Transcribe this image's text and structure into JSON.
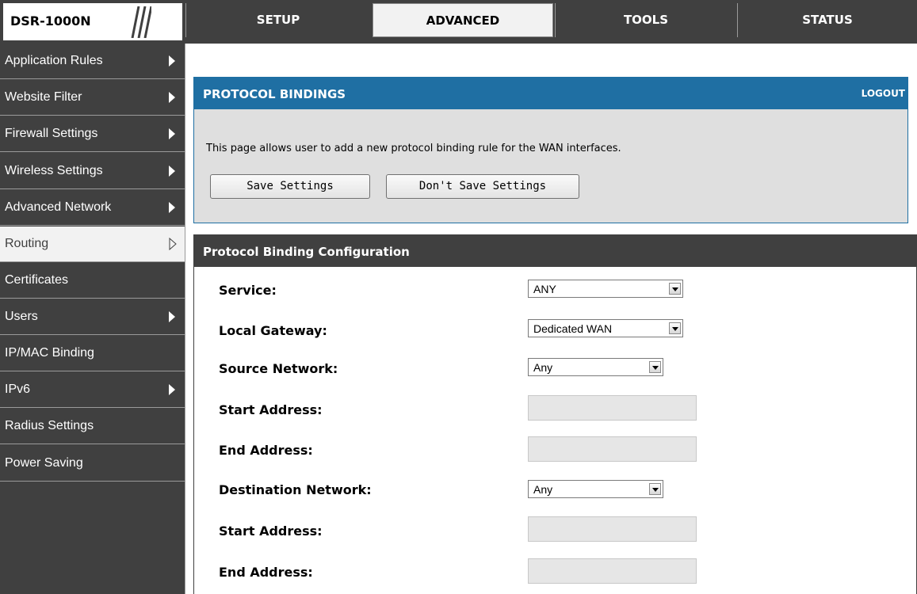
{
  "header": {
    "model": "DSR-1000N",
    "tabs": [
      {
        "label": "SETUP"
      },
      {
        "label": "ADVANCED"
      },
      {
        "label": "TOOLS"
      },
      {
        "label": "STATUS"
      }
    ],
    "active_tab": "ADVANCED"
  },
  "sidebar": {
    "items": [
      {
        "label": "Application Rules"
      },
      {
        "label": "Website Filter"
      },
      {
        "label": "Firewall Settings"
      },
      {
        "label": "Wireless Settings"
      },
      {
        "label": "Advanced Network"
      },
      {
        "label": "Routing"
      },
      {
        "label": "Certificates"
      },
      {
        "label": "Users"
      },
      {
        "label": "IP/MAC Binding"
      },
      {
        "label": "IPv6"
      },
      {
        "label": "Radius Settings"
      },
      {
        "label": "Power Saving"
      }
    ],
    "active_item": "Routing"
  },
  "intro": {
    "title": "PROTOCOL BINDINGS",
    "logout": "LOGOUT",
    "description": "This page allows user to add a new protocol binding rule for the WAN interfaces.",
    "save_label": "Save Settings",
    "dont_save_label": "Don't Save Settings"
  },
  "config": {
    "title": "Protocol Binding Configuration",
    "fields": [
      {
        "label": "Service:",
        "type": "select",
        "value": "ANY"
      },
      {
        "label": "Local Gateway:",
        "type": "select",
        "value": "Dedicated WAN"
      },
      {
        "label": "Source Network:",
        "type": "select",
        "value": "Any"
      },
      {
        "label": "Start Address:",
        "type": "text",
        "value": ""
      },
      {
        "label": "End Address:",
        "type": "text",
        "value": ""
      },
      {
        "label": "Destination Network:",
        "type": "select",
        "value": "Any"
      },
      {
        "label": "Start Address:",
        "type": "text",
        "value": ""
      },
      {
        "label": "End Address:",
        "type": "text",
        "value": ""
      }
    ]
  },
  "colors": {
    "chrome": "#404040",
    "accent_blue": "#1f6fa3",
    "panel_grey": "#dfdfdf"
  }
}
